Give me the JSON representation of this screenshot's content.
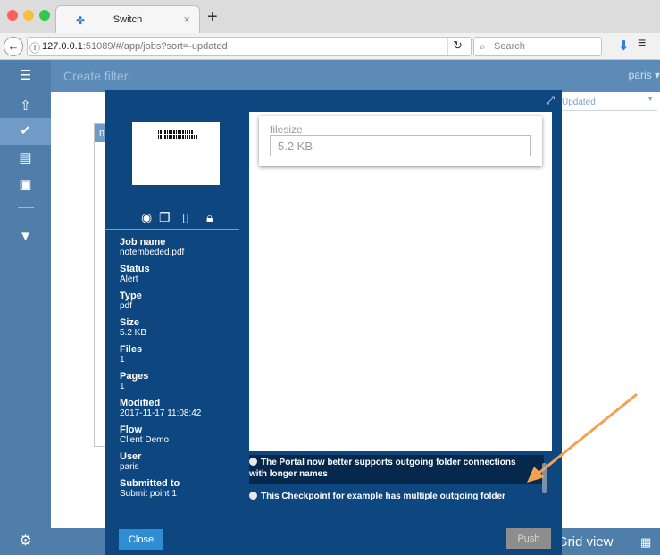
{
  "browser": {
    "tab_title": "Switch",
    "url_host": "127.0.0.1",
    "url_rest": ":51089/#/app/jobs?sort=-updated",
    "search_placeholder": "Search"
  },
  "app": {
    "create_filter": "Create filter",
    "user": "paris ▾",
    "sort_label": "Updated",
    "card_peek_letter": "n",
    "grid_view": "Grid view"
  },
  "modal": {
    "metadata": [
      {
        "label": "Job name",
        "value": "notembeded.pdf"
      },
      {
        "label": "Status",
        "value": "Alert"
      },
      {
        "label": "Type",
        "value": "pdf"
      },
      {
        "label": "Size",
        "value": "5.2 KB"
      },
      {
        "label": "Files",
        "value": "1"
      },
      {
        "label": "Pages",
        "value": "1"
      },
      {
        "label": "Modified",
        "value": "2017-11-17 11:08:42"
      },
      {
        "label": "Flow",
        "value": "Client Demo"
      },
      {
        "label": "User",
        "value": "paris"
      },
      {
        "label": "Submitted to",
        "value": "Submit point 1"
      }
    ],
    "field": {
      "label": "filesize",
      "value": "5.2 KB"
    },
    "notes": [
      "The Portal now better supports outgoing folder connections with longer names",
      "This Checkpoint for example has multiple outgoing folder"
    ],
    "close_label": "Close",
    "push_label": "Push"
  },
  "colors": {
    "sidebar": "#4f7eab",
    "modal_bg": "#0e4680",
    "close_button": "#2f8ed3",
    "push_button": "#8d8d8d",
    "arrow": "#f3a04f"
  }
}
